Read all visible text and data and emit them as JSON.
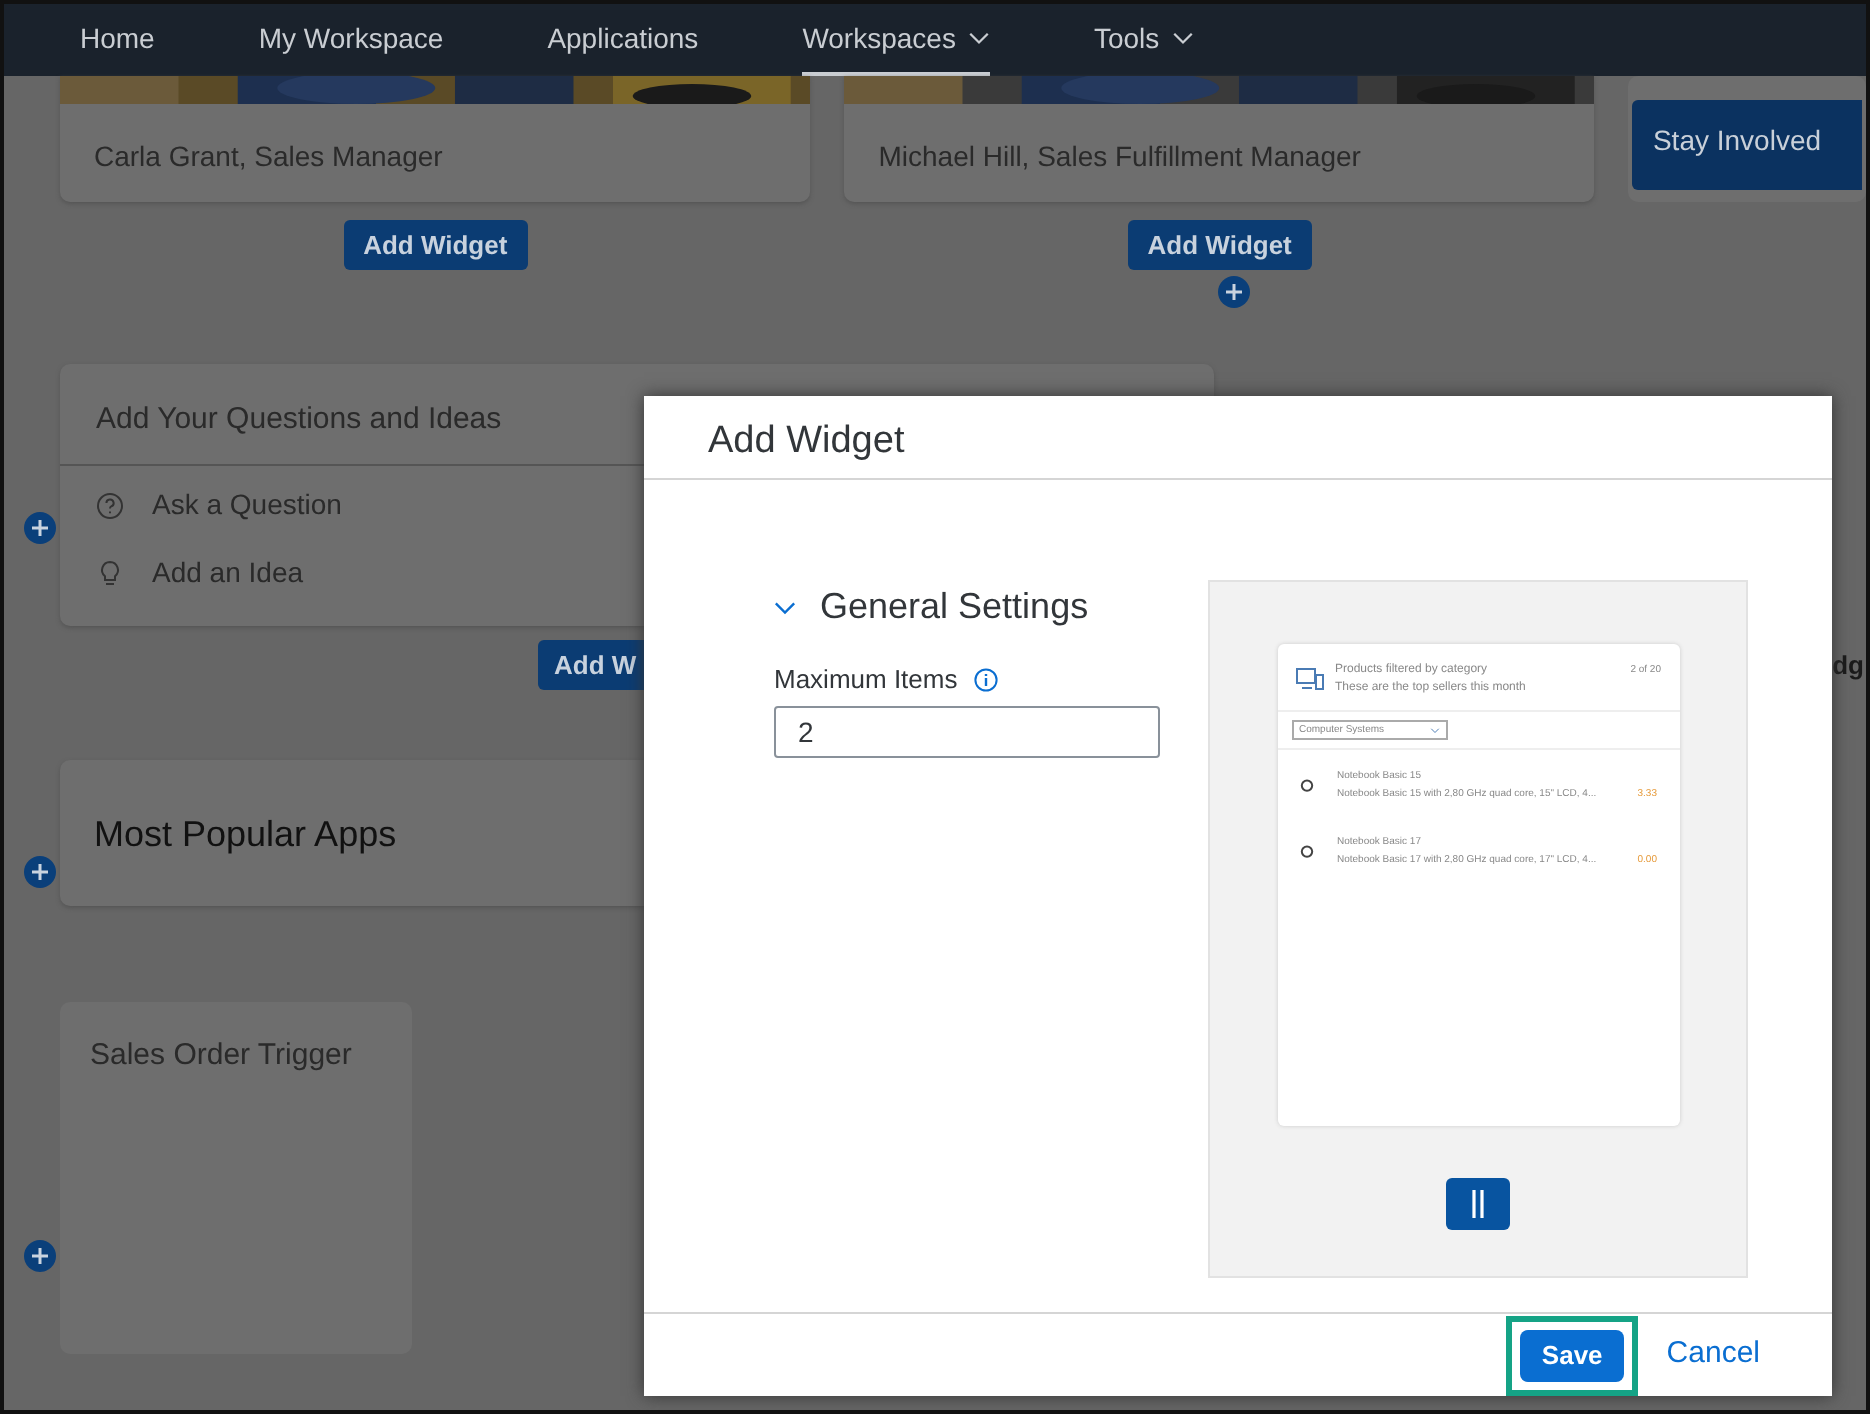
{
  "nav": [
    {
      "label": "Home",
      "selected": false,
      "dropdown": false
    },
    {
      "label": "My Workspace",
      "selected": false,
      "dropdown": false
    },
    {
      "label": "Applications",
      "selected": false,
      "dropdown": false
    },
    {
      "label": "Workspaces",
      "selected": true,
      "dropdown": true
    },
    {
      "label": "Tools",
      "selected": false,
      "dropdown": true
    }
  ],
  "top_cards": [
    {
      "caption": "Carla Grant, Sales Manager",
      "button": "Add Widget"
    },
    {
      "caption": "Michael Hill, Sales Fulfillment Manager",
      "button": "Add Widget"
    }
  ],
  "stay_involved": {
    "title": "Stay Involved"
  },
  "questions_card": {
    "title": "Add Your Questions and Ideas",
    "links": [
      {
        "kind": "question",
        "label": "Ask a Question"
      },
      {
        "kind": "idea",
        "label": "Add an Idea"
      }
    ],
    "button": "Add W"
  },
  "right_partial": "dg",
  "popular_card": {
    "title": "Most Popular Apps"
  },
  "trigger_card": {
    "title": "Sales Order Trigger"
  },
  "dialog": {
    "title": "Add Widget",
    "section": {
      "title": "General Settings",
      "expanded": true
    },
    "field": {
      "label": "Maximum Items",
      "value": "2"
    },
    "preview": {
      "title": "Products filtered by category",
      "subtitle": "These are the top sellers this month",
      "counter": "2 of 20",
      "filter": "Computer Systems",
      "items": [
        {
          "name": "Notebook Basic 15",
          "description": "Notebook Basic 15 with 2,80 GHz quad core, 15\" LCD, 4...",
          "value": "3.33"
        },
        {
          "name": "Notebook Basic 17",
          "description": "Notebook Basic 17 with 2,80 GHz quad core, 17\" LCD, 4...",
          "value": "0.00"
        }
      ]
    },
    "save": {
      "label": "Save",
      "highlighted": true
    },
    "cancel": {
      "label": "Cancel"
    }
  }
}
